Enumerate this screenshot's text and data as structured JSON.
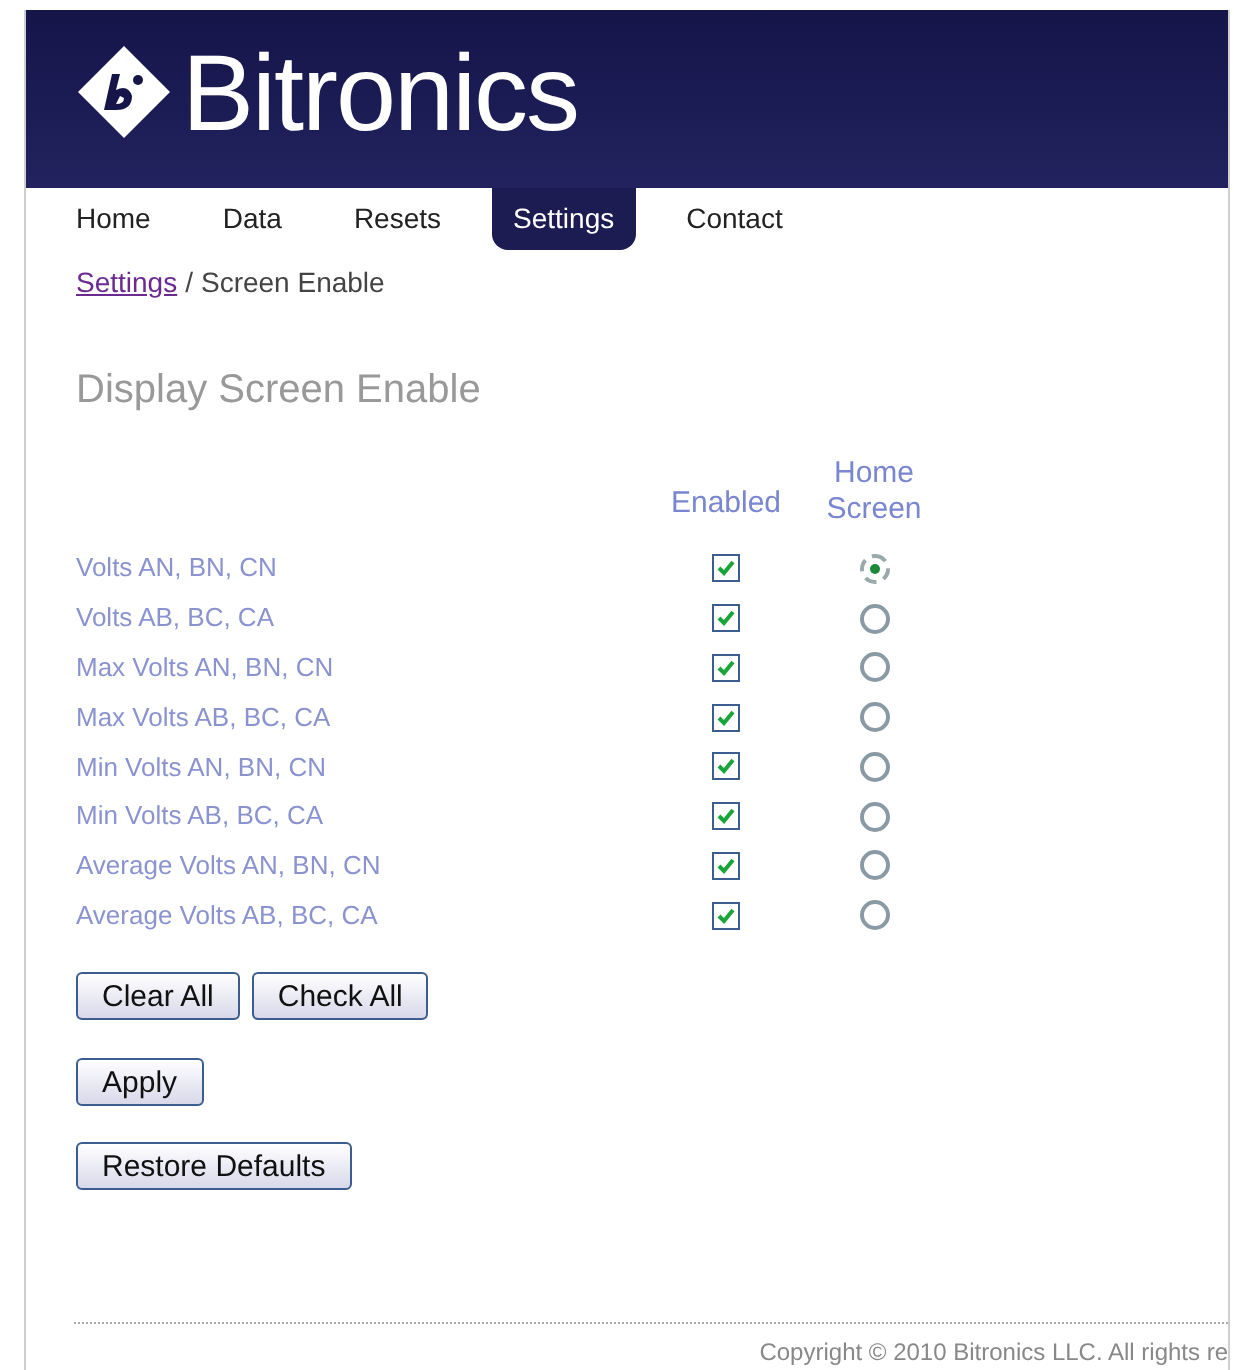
{
  "header": {
    "logo_text": "Bitronics"
  },
  "nav": [
    {
      "label": "Home",
      "selected": false
    },
    {
      "label": "Data",
      "selected": false
    },
    {
      "label": "Resets",
      "selected": false
    },
    {
      "label": "Settings",
      "selected": true
    },
    {
      "label": "Contact",
      "selected": false
    }
  ],
  "breadcrumb": {
    "link": "Settings",
    "separator": "/",
    "current": "Screen Enable"
  },
  "title": "Display Screen Enable",
  "columns": {
    "enabled": "Enabled",
    "home_screen": "Home Screen"
  },
  "rows": [
    {
      "label": "Volts AN, BN, CN",
      "enabled": true,
      "home": true
    },
    {
      "label": "Volts AB, BC, CA",
      "enabled": true,
      "home": false
    },
    {
      "label": "Max Volts AN, BN, CN",
      "enabled": true,
      "home": false
    },
    {
      "label": "Max Volts AB, BC, CA",
      "enabled": true,
      "home": false
    },
    {
      "label": "Min Volts AN, BN, CN",
      "enabled": true,
      "home": false
    },
    {
      "label": "Min Volts AB, BC, CA",
      "enabled": true,
      "home": false
    },
    {
      "label": "Average Volts AN, BN, CN",
      "enabled": true,
      "home": false
    },
    {
      "label": "Average Volts AB, BC, CA",
      "enabled": true,
      "home": false
    }
  ],
  "buttons": {
    "clear_all": "Clear All",
    "check_all": "Check All",
    "apply": "Apply",
    "restore": "Restore Defaults"
  },
  "footer": {
    "copyright": "Copyright © 2010 Bitronics LLC. All rights re"
  }
}
